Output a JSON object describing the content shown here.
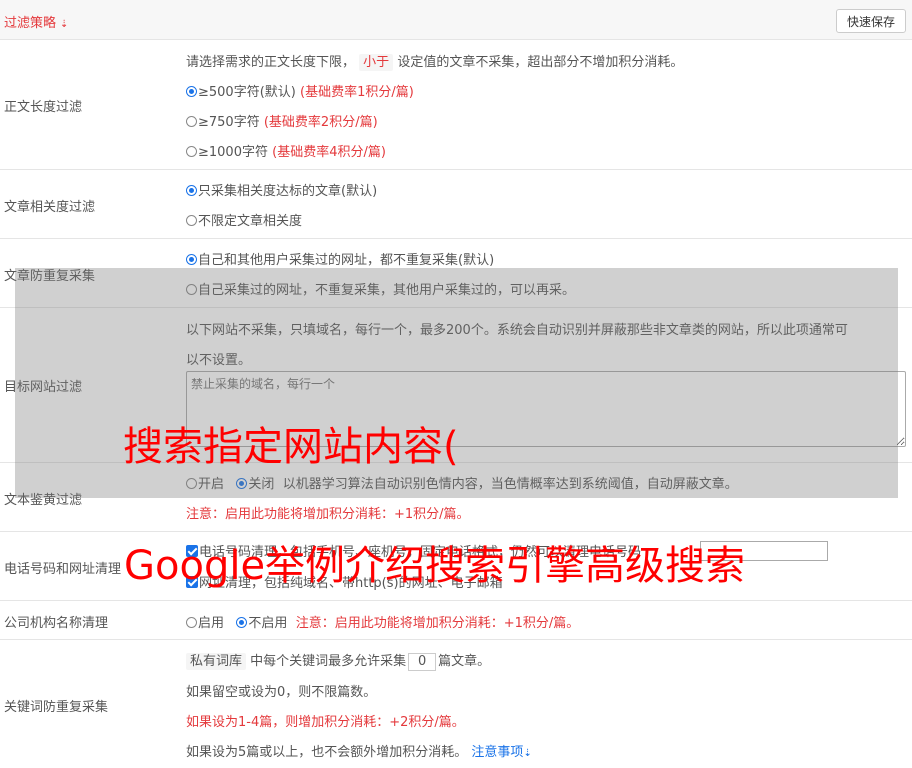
{
  "header": {
    "title": "过滤策略",
    "chevron": "chevron-double-down-icon",
    "save_label": "快速保存"
  },
  "rows": {
    "length": {
      "label": "正文长度过滤",
      "desc_pre": "请选择需求的正文长度下限，",
      "desc_badge": "小于",
      "desc_post": "设定值的文章不采集，超出部分不增加积分消耗。",
      "options": [
        {
          "text": "≥500字符(默认)",
          "note": "(基础费率1积分/篇)",
          "selected": true
        },
        {
          "text": "≥750字符",
          "note": "(基础费率2积分/篇)",
          "selected": false
        },
        {
          "text": "≥1000字符",
          "note": "(基础费率4积分/篇)",
          "selected": false
        }
      ]
    },
    "relevance": {
      "label": "文章相关度过滤",
      "options": [
        {
          "text": "只采集相关度达标的文章(默认)",
          "selected": true
        },
        {
          "text": "不限定文章相关度",
          "selected": false
        }
      ]
    },
    "dedupe": {
      "label": "文章防重复采集",
      "options": [
        {
          "text": "自己和其他用户采集过的网址，都不重复采集(默认)",
          "selected": true
        },
        {
          "text": "自己采集过的网址，不重复采集，其他用户采集过的，可以再采。",
          "selected": false
        }
      ]
    },
    "site": {
      "label": "目标网站过滤",
      "desc1": "以下网站不采集，只填域名，每行一个，最多200个。系统会自动识别并屏蔽那些非文章类的网站，所以此项通常可",
      "desc2": "以不设置。",
      "placeholder": "禁止采集的域名，每行一个"
    },
    "porn": {
      "label": "文本鉴黄过滤",
      "opt_on": "开启",
      "opt_off": "关闭",
      "desc": "以机器学习算法自动识别色情内容，当色情概率达到系统阈值，自动屏蔽文章。",
      "note": "注意：启用此功能将增加积分消耗：+1积分/篇。"
    },
    "phone": {
      "label": "电话号码和网址清理",
      "line1": "电话号码清理，包括手机号、座机号，固定电话格式，仍然可以清理电话号码",
      "line2": "网址清理，包括纯域名、带http(s)的网址、电子邮箱"
    },
    "company": {
      "label": "公司机构名称清理",
      "opt_on": "启用",
      "opt_off": "不启用",
      "note": "注意：启用此功能将增加积分消耗：+1积分/篇。"
    },
    "keyword": {
      "label": "关键词防重复采集",
      "badge": "私有词库",
      "pre": "中每个关键词最多允许采集",
      "value": "0",
      "post": "篇文章。",
      "line2": "如果留空或设为0，则不限篇数。",
      "line3": "如果设为1-4篇，则增加积分消耗：+2积分/篇。",
      "line4": "如果设为5篇或以上，也不会额外增加积分消耗。",
      "link": "注意事项"
    }
  },
  "watermark": {
    "line1": "搜索指定网站内容(",
    "line2": "Google举例介绍搜索引擎高级搜索"
  }
}
